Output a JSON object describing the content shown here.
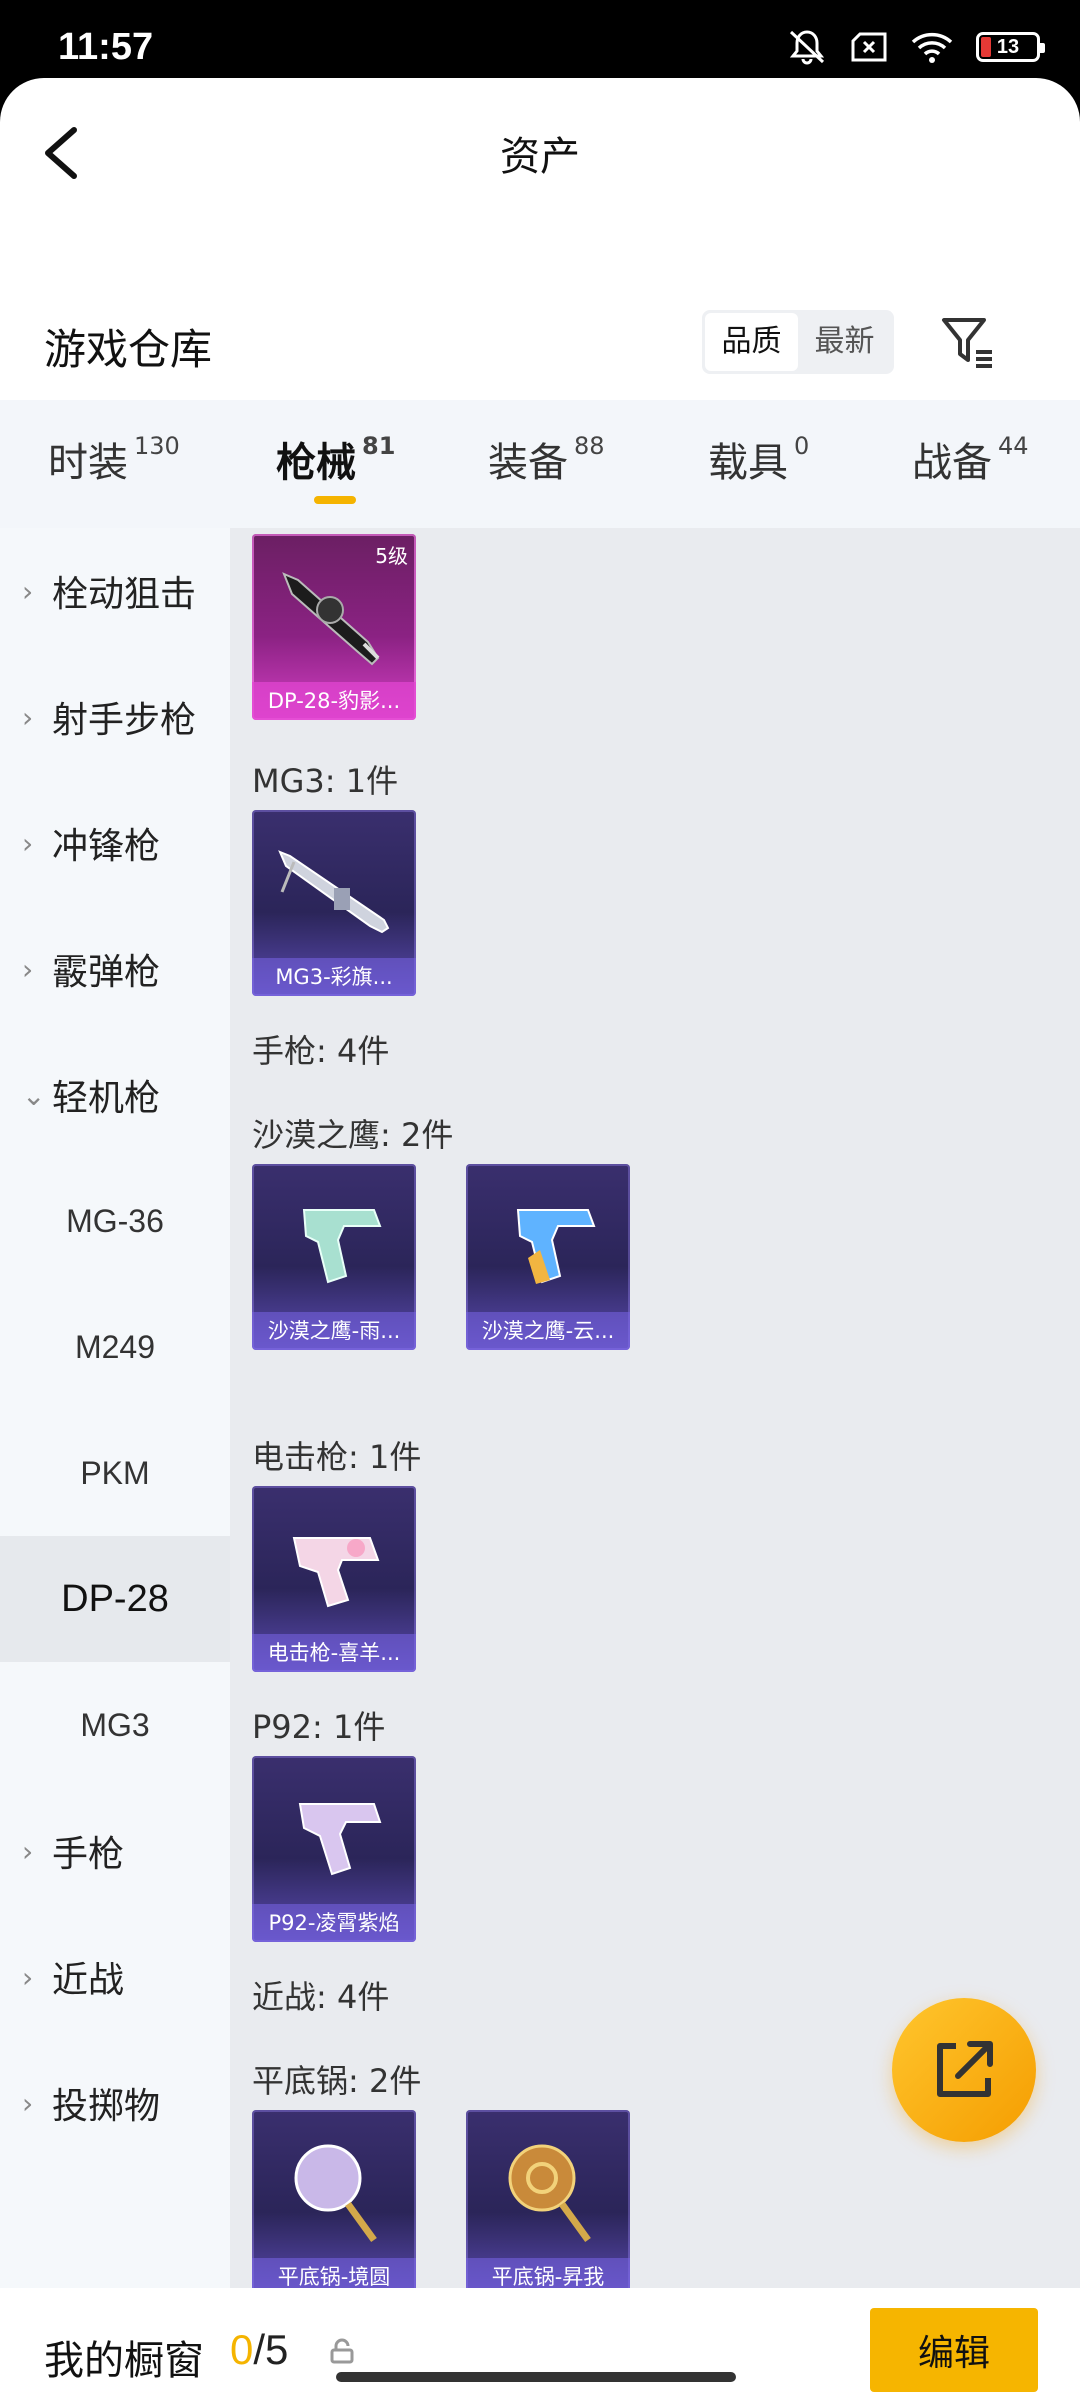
{
  "status": {
    "time": "11:57",
    "battery": "13"
  },
  "header": {
    "title": "资产"
  },
  "warehouse": {
    "title": "游戏仓库",
    "sort_options": [
      "品质",
      "最新"
    ]
  },
  "tabs": [
    {
      "label": "时装",
      "count": "130"
    },
    {
      "label": "枪械",
      "count": "81"
    },
    {
      "label": "装备",
      "count": "88"
    },
    {
      "label": "载具",
      "count": "0"
    },
    {
      "label": "战备",
      "count": "44"
    }
  ],
  "sidebar": {
    "items": [
      {
        "label": "栓动狙击",
        "chevron": "›"
      },
      {
        "label": "射手步枪",
        "chevron": "›"
      },
      {
        "label": "冲锋枪",
        "chevron": "›"
      },
      {
        "label": "霰弹枪",
        "chevron": "›"
      },
      {
        "label": "轻机枪",
        "chevron": "⌄"
      },
      {
        "label": "MG-36"
      },
      {
        "label": "M249"
      },
      {
        "label": "PKM"
      },
      {
        "label": "DP-28"
      },
      {
        "label": "MG3"
      },
      {
        "label": "手枪",
        "chevron": "›"
      },
      {
        "label": "近战",
        "chevron": "›"
      },
      {
        "label": "投掷物",
        "chevron": "›"
      }
    ]
  },
  "content": {
    "sections": [
      "MG3: 1件",
      "手枪: 4件",
      "沙漠之鹰: 2件",
      "电击枪: 1件",
      "P92: 1件",
      "近战: 4件",
      "平底锅: 2件"
    ],
    "cards": [
      {
        "name": "DP-28-豹影...",
        "level": "5级"
      },
      {
        "name": "MG3-彩旗..."
      },
      {
        "name": "沙漠之鹰-雨..."
      },
      {
        "name": "沙漠之鹰-云..."
      },
      {
        "name": "电击枪-喜羊..."
      },
      {
        "name": "P92-凌霄紫焰"
      },
      {
        "name": "平底锅-境圆"
      },
      {
        "name": "平底锅-昇我"
      }
    ]
  },
  "bottom": {
    "label": "我的橱窗",
    "count_used": "0",
    "count_total": "/5",
    "edit_label": "编辑"
  }
}
